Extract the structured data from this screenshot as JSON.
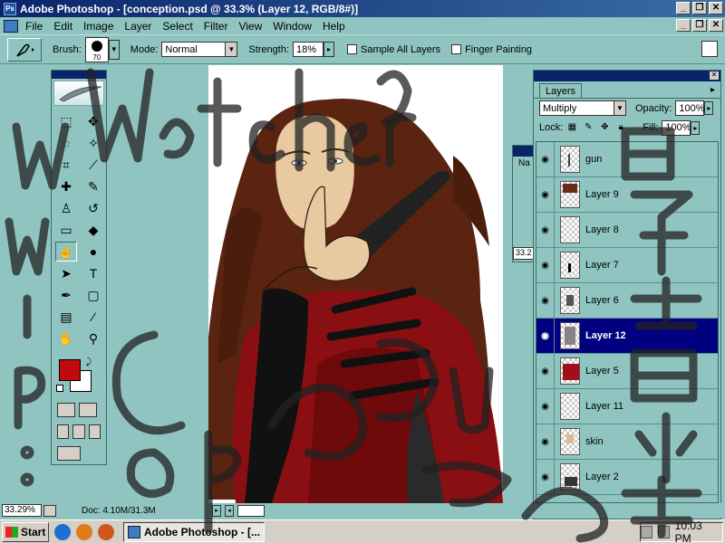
{
  "window": {
    "title": "Adobe Photoshop - [conception.psd @ 33.3% (Layer 12, RGB/8#)]",
    "min": "_",
    "restore": "❐",
    "close": "✕"
  },
  "menu": [
    "File",
    "Edit",
    "Image",
    "Layer",
    "Select",
    "Filter",
    "View",
    "Window",
    "Help"
  ],
  "options": {
    "brush_label": "Brush:",
    "brush_size": "70",
    "mode_label": "Mode:",
    "mode_value": "Normal",
    "strength_label": "Strength:",
    "strength_value": "18%",
    "sample_all_layers": "Sample All Layers",
    "finger_painting": "Finger Painting"
  },
  "colors": {
    "foreground": "#c00a10",
    "background": "#ffffff"
  },
  "layers_panel": {
    "tab": "Layers",
    "blend_mode": "Multiply",
    "opacity_label": "Opacity:",
    "opacity_value": "100%",
    "lock_label": "Lock:",
    "fill_label": "Fill:",
    "fill_value": "100%",
    "layers": [
      {
        "name": "gun",
        "active": false
      },
      {
        "name": "Layer 9",
        "active": false
      },
      {
        "name": "Layer 8",
        "active": false
      },
      {
        "name": "Layer 7",
        "active": false
      },
      {
        "name": "Layer 6",
        "active": false
      },
      {
        "name": "Layer 12",
        "active": true
      },
      {
        "name": "Layer 5",
        "active": false
      },
      {
        "name": "Layer 11",
        "active": false
      },
      {
        "name": "skin",
        "active": false
      },
      {
        "name": "Layer 2",
        "active": false
      }
    ]
  },
  "navigator": {
    "tab": "Na",
    "zoom": "33.2"
  },
  "status": {
    "zoom": "33.29%",
    "doc": "Doc: 4.10M/31.3M"
  },
  "taskbar": {
    "start": "Start",
    "task": "Adobe Photoshop - [...",
    "time": "10:03 PM"
  }
}
